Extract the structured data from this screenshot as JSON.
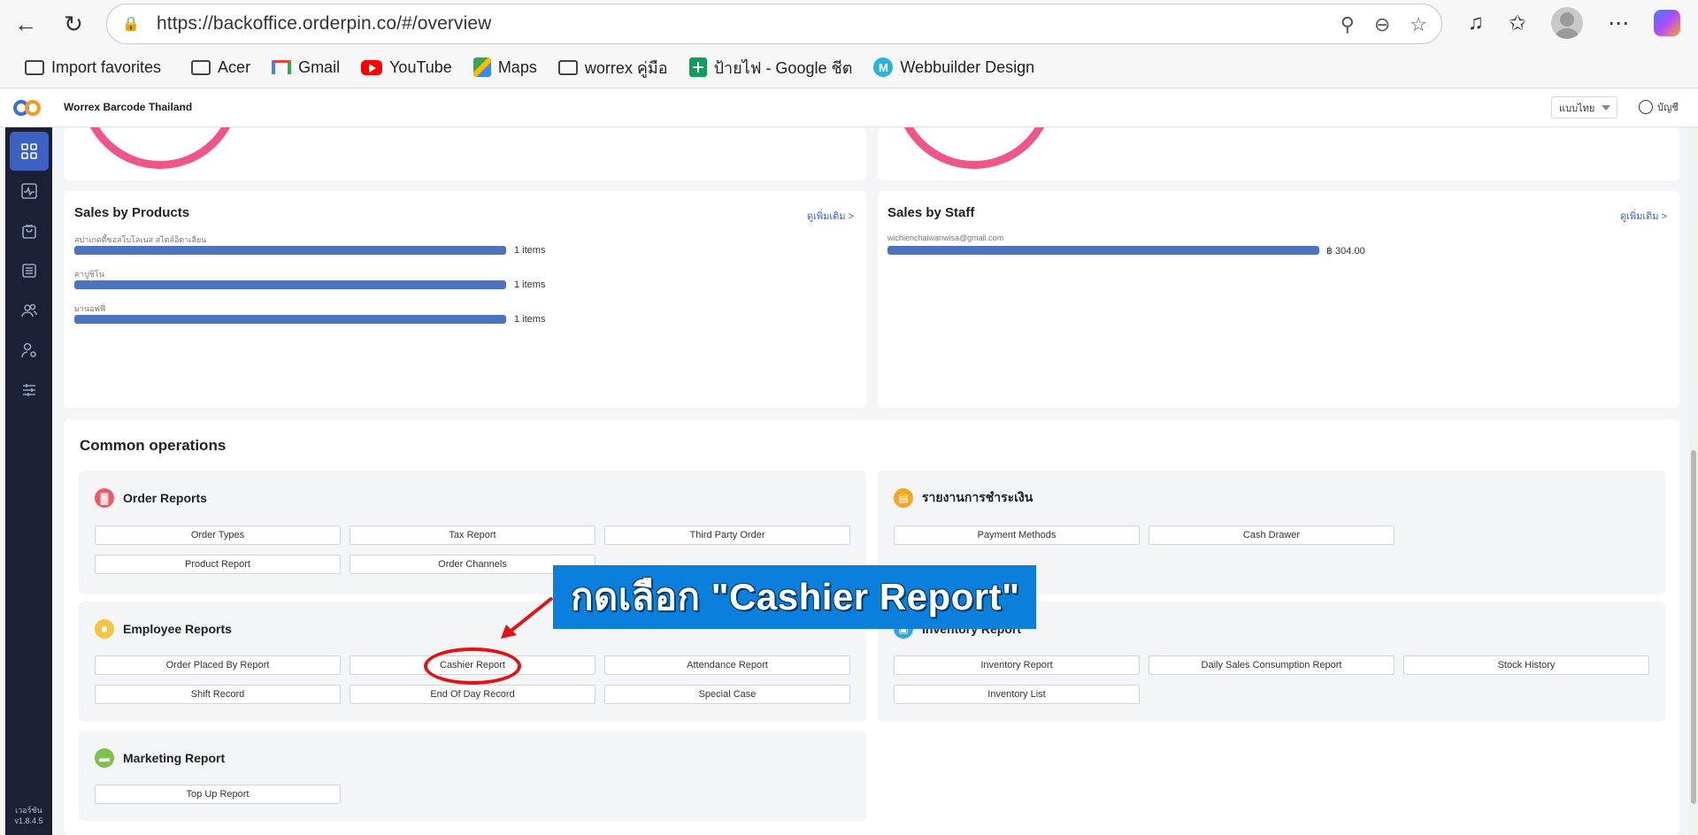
{
  "browser": {
    "url": "https://backoffice.orderpin.co/#/overview",
    "bookmarks": [
      {
        "label": "Import favorites",
        "icon": "import-icon"
      },
      {
        "label": "Acer",
        "icon": "folder-icon"
      },
      {
        "label": "Gmail",
        "icon": "gmail-icon"
      },
      {
        "label": "YouTube",
        "icon": "youtube-icon"
      },
      {
        "label": "Maps",
        "icon": "maps-icon"
      },
      {
        "label": "worrex คู่มือ",
        "icon": "folder-icon"
      },
      {
        "label": "ป้ายไฟ - Google ชีต",
        "icon": "sheets-icon"
      },
      {
        "label": "Webbuilder Design",
        "icon": "webbuilder-icon"
      }
    ]
  },
  "app": {
    "name": "Worrex Barcode Thailand",
    "language": "แบบไทย",
    "account": "บัญชี",
    "version_label": "เวอร์ชัน",
    "version": "v1.8.4.5"
  },
  "sales_products": {
    "title": "Sales by Products",
    "more": "ดูเพิ่มเติม >",
    "items": [
      {
        "label": "สปาเกตตี้ซอสโบโลเนส สไตล์อิตาเลียน",
        "value": "1 items",
        "fraction": 1.0
      },
      {
        "label": "คาปูชิโน",
        "value": "1 items",
        "fraction": 1.0
      },
      {
        "label": "มานอฟฟี่",
        "value": "1 items",
        "fraction": 1.0
      }
    ]
  },
  "sales_staff": {
    "title": "Sales by Staff",
    "more": "ดูเพิ่มเติม >",
    "items": [
      {
        "label": "wichienchaiwanwisa@gmail.com",
        "value": "฿ 304.00",
        "fraction": 1.0
      }
    ]
  },
  "common": {
    "title": "Common operations",
    "order_reports": {
      "title": "Order Reports",
      "buttons": [
        "Order Types",
        "Tax Report",
        "Third Party Order",
        "Product Report",
        "Order Channels"
      ]
    },
    "payment_reports": {
      "title": "รายงานการชำระเงิน",
      "buttons": [
        "Payment Methods",
        "Cash Drawer"
      ]
    },
    "employee_reports": {
      "title": "Employee Reports",
      "buttons": [
        "Order Placed By Report",
        "Cashier Report",
        "Attendance Report",
        "Shift Record",
        "End Of Day Record",
        "Special Case"
      ]
    },
    "inventory_reports": {
      "title": "Inventory Report",
      "buttons": [
        "Inventory Report",
        "Daily Sales Consumption Report",
        "Stock History",
        "Inventory List"
      ]
    },
    "marketing_reports": {
      "title": "Marketing Report",
      "buttons": [
        "Top Up Report"
      ]
    }
  },
  "annotation": {
    "text": "กดเลือก \"Cashier Report\"",
    "color": "#0a80dc",
    "highlight_color": "#e01414"
  }
}
